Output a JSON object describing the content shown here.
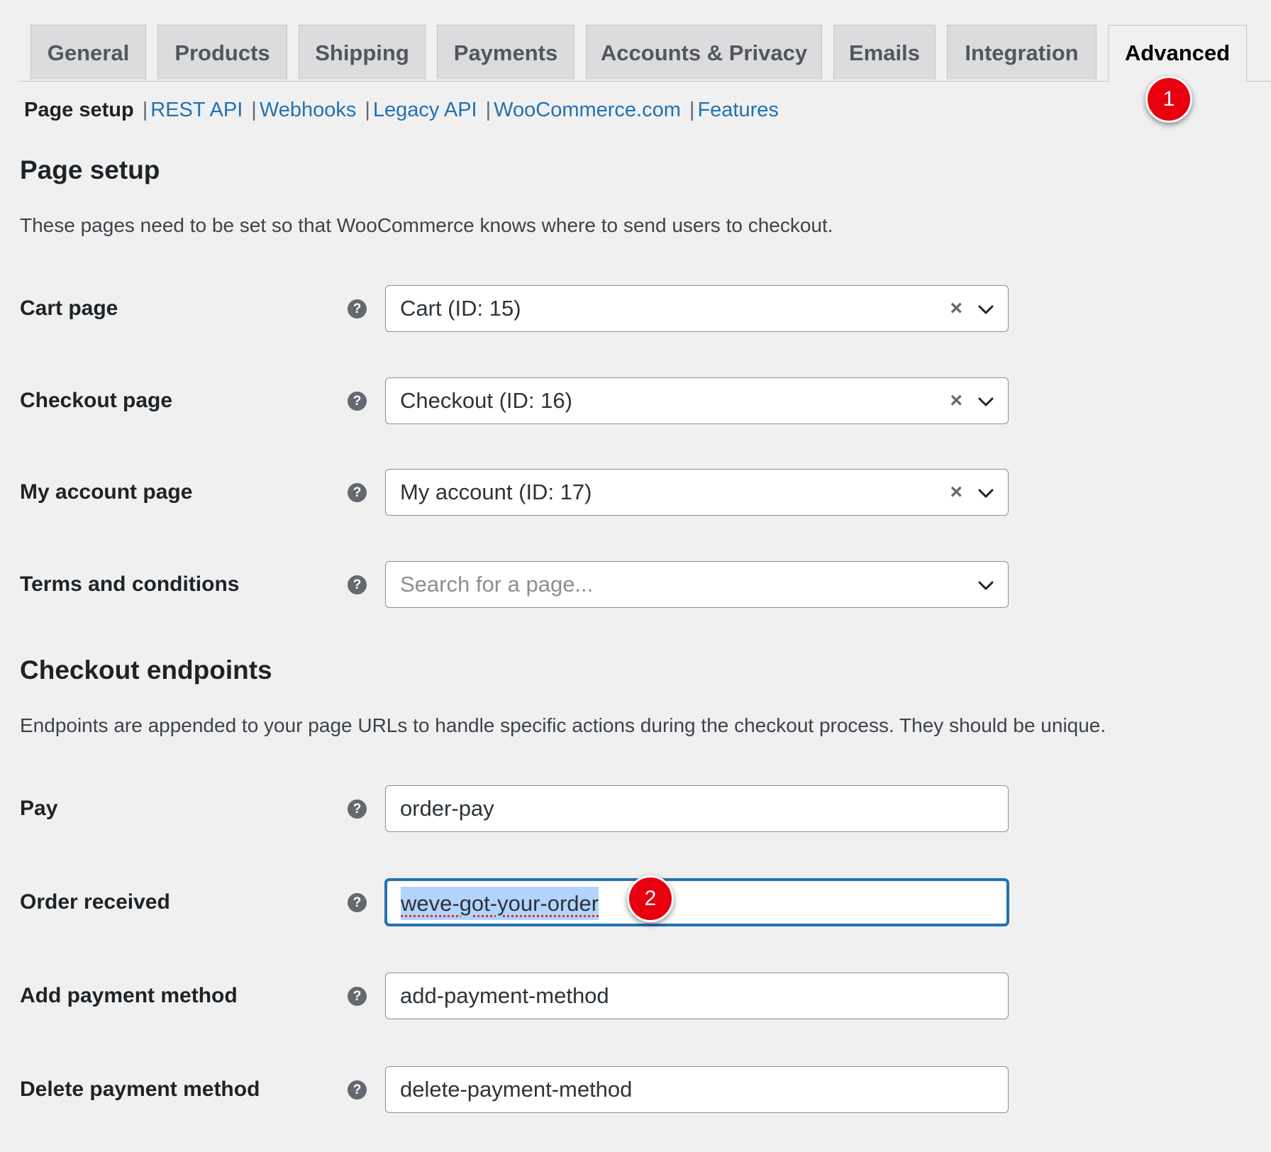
{
  "tabs": [
    {
      "label": "General"
    },
    {
      "label": "Products"
    },
    {
      "label": "Shipping"
    },
    {
      "label": "Payments"
    },
    {
      "label": "Accounts & Privacy"
    },
    {
      "label": "Emails"
    },
    {
      "label": "Integration"
    },
    {
      "label": "Advanced"
    }
  ],
  "active_tab": "Advanced",
  "badges": {
    "one": "1",
    "two": "2"
  },
  "subnav": {
    "current": "Page setup",
    "links": [
      "REST API",
      "Webhooks",
      "Legacy API",
      "WooCommerce.com",
      "Features"
    ]
  },
  "page_setup": {
    "title": "Page setup",
    "description": "These pages need to be set so that WooCommerce knows where to send users to checkout.",
    "rows": [
      {
        "label": "Cart page",
        "value": "Cart (ID: 15)"
      },
      {
        "label": "Checkout page",
        "value": "Checkout (ID: 16)"
      },
      {
        "label": "My account page",
        "value": "My account (ID: 17)"
      },
      {
        "label": "Terms and conditions",
        "placeholder": "Search for a page..."
      }
    ]
  },
  "endpoints": {
    "title": "Checkout endpoints",
    "description": "Endpoints are appended to your page URLs to handle specific actions during the checkout process. They should be unique.",
    "rows": [
      {
        "label": "Pay",
        "value": "order-pay"
      },
      {
        "label": "Order received",
        "value": "weve-got-your-order"
      },
      {
        "label": "Add payment method",
        "value": "add-payment-method"
      },
      {
        "label": "Delete payment method",
        "value": "delete-payment-method"
      }
    ]
  },
  "icons": {
    "help": "help-icon",
    "clear": "clear-icon",
    "dropdown": "chevron-down-icon"
  },
  "colors": {
    "link": "#2271b1",
    "badge": "#e8000e",
    "focus": "#2271b1",
    "selection": "#b3d4fc"
  }
}
